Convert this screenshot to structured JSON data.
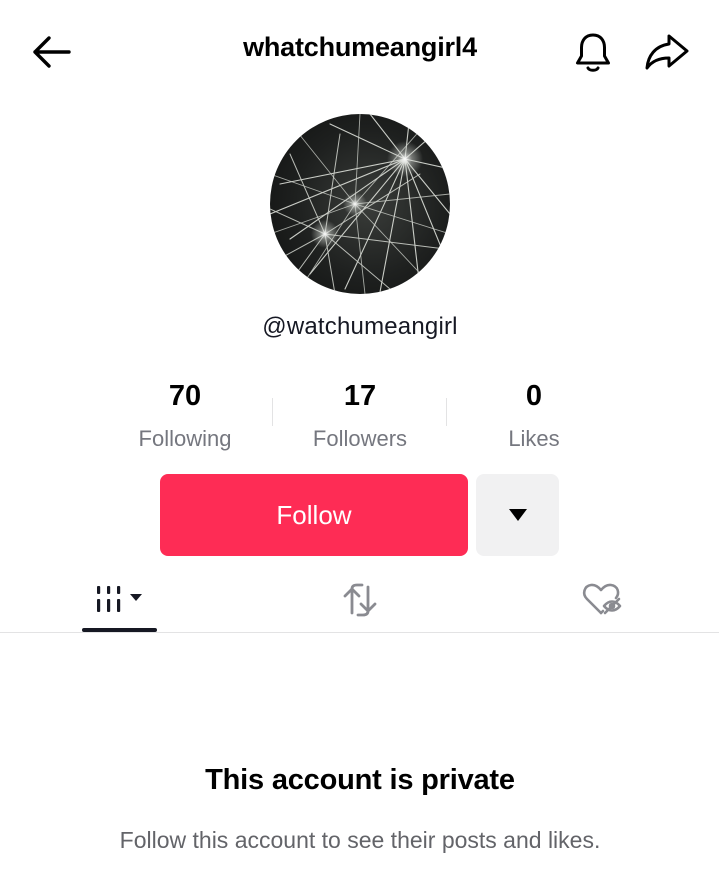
{
  "header": {
    "title": "whatchumeangirl4",
    "back_icon": "arrow-left-icon",
    "notify_icon": "bell-icon",
    "share_icon": "share-arrow-icon"
  },
  "profile": {
    "avatar_icon": "starburst-avatar",
    "username": "@watchumeangirl"
  },
  "stats": [
    {
      "value": "70",
      "label": "Following"
    },
    {
      "value": "17",
      "label": "Followers"
    },
    {
      "value": "0",
      "label": "Likes"
    }
  ],
  "actions": {
    "follow_label": "Follow",
    "more_icon": "caret-down-icon"
  },
  "tabs": [
    {
      "name": "videos",
      "icon": "grid-icon",
      "active": true
    },
    {
      "name": "reposts",
      "icon": "repost-icon",
      "active": false
    },
    {
      "name": "liked",
      "icon": "hidden-heart-icon",
      "active": false
    }
  ],
  "private": {
    "title": "This account is private",
    "description": "Follow this account to see their posts and likes."
  },
  "colors": {
    "accent": "#fe2c55",
    "text_primary": "#161823",
    "text_secondary": "#75777f",
    "secondary_button": "#f1f1f2"
  }
}
